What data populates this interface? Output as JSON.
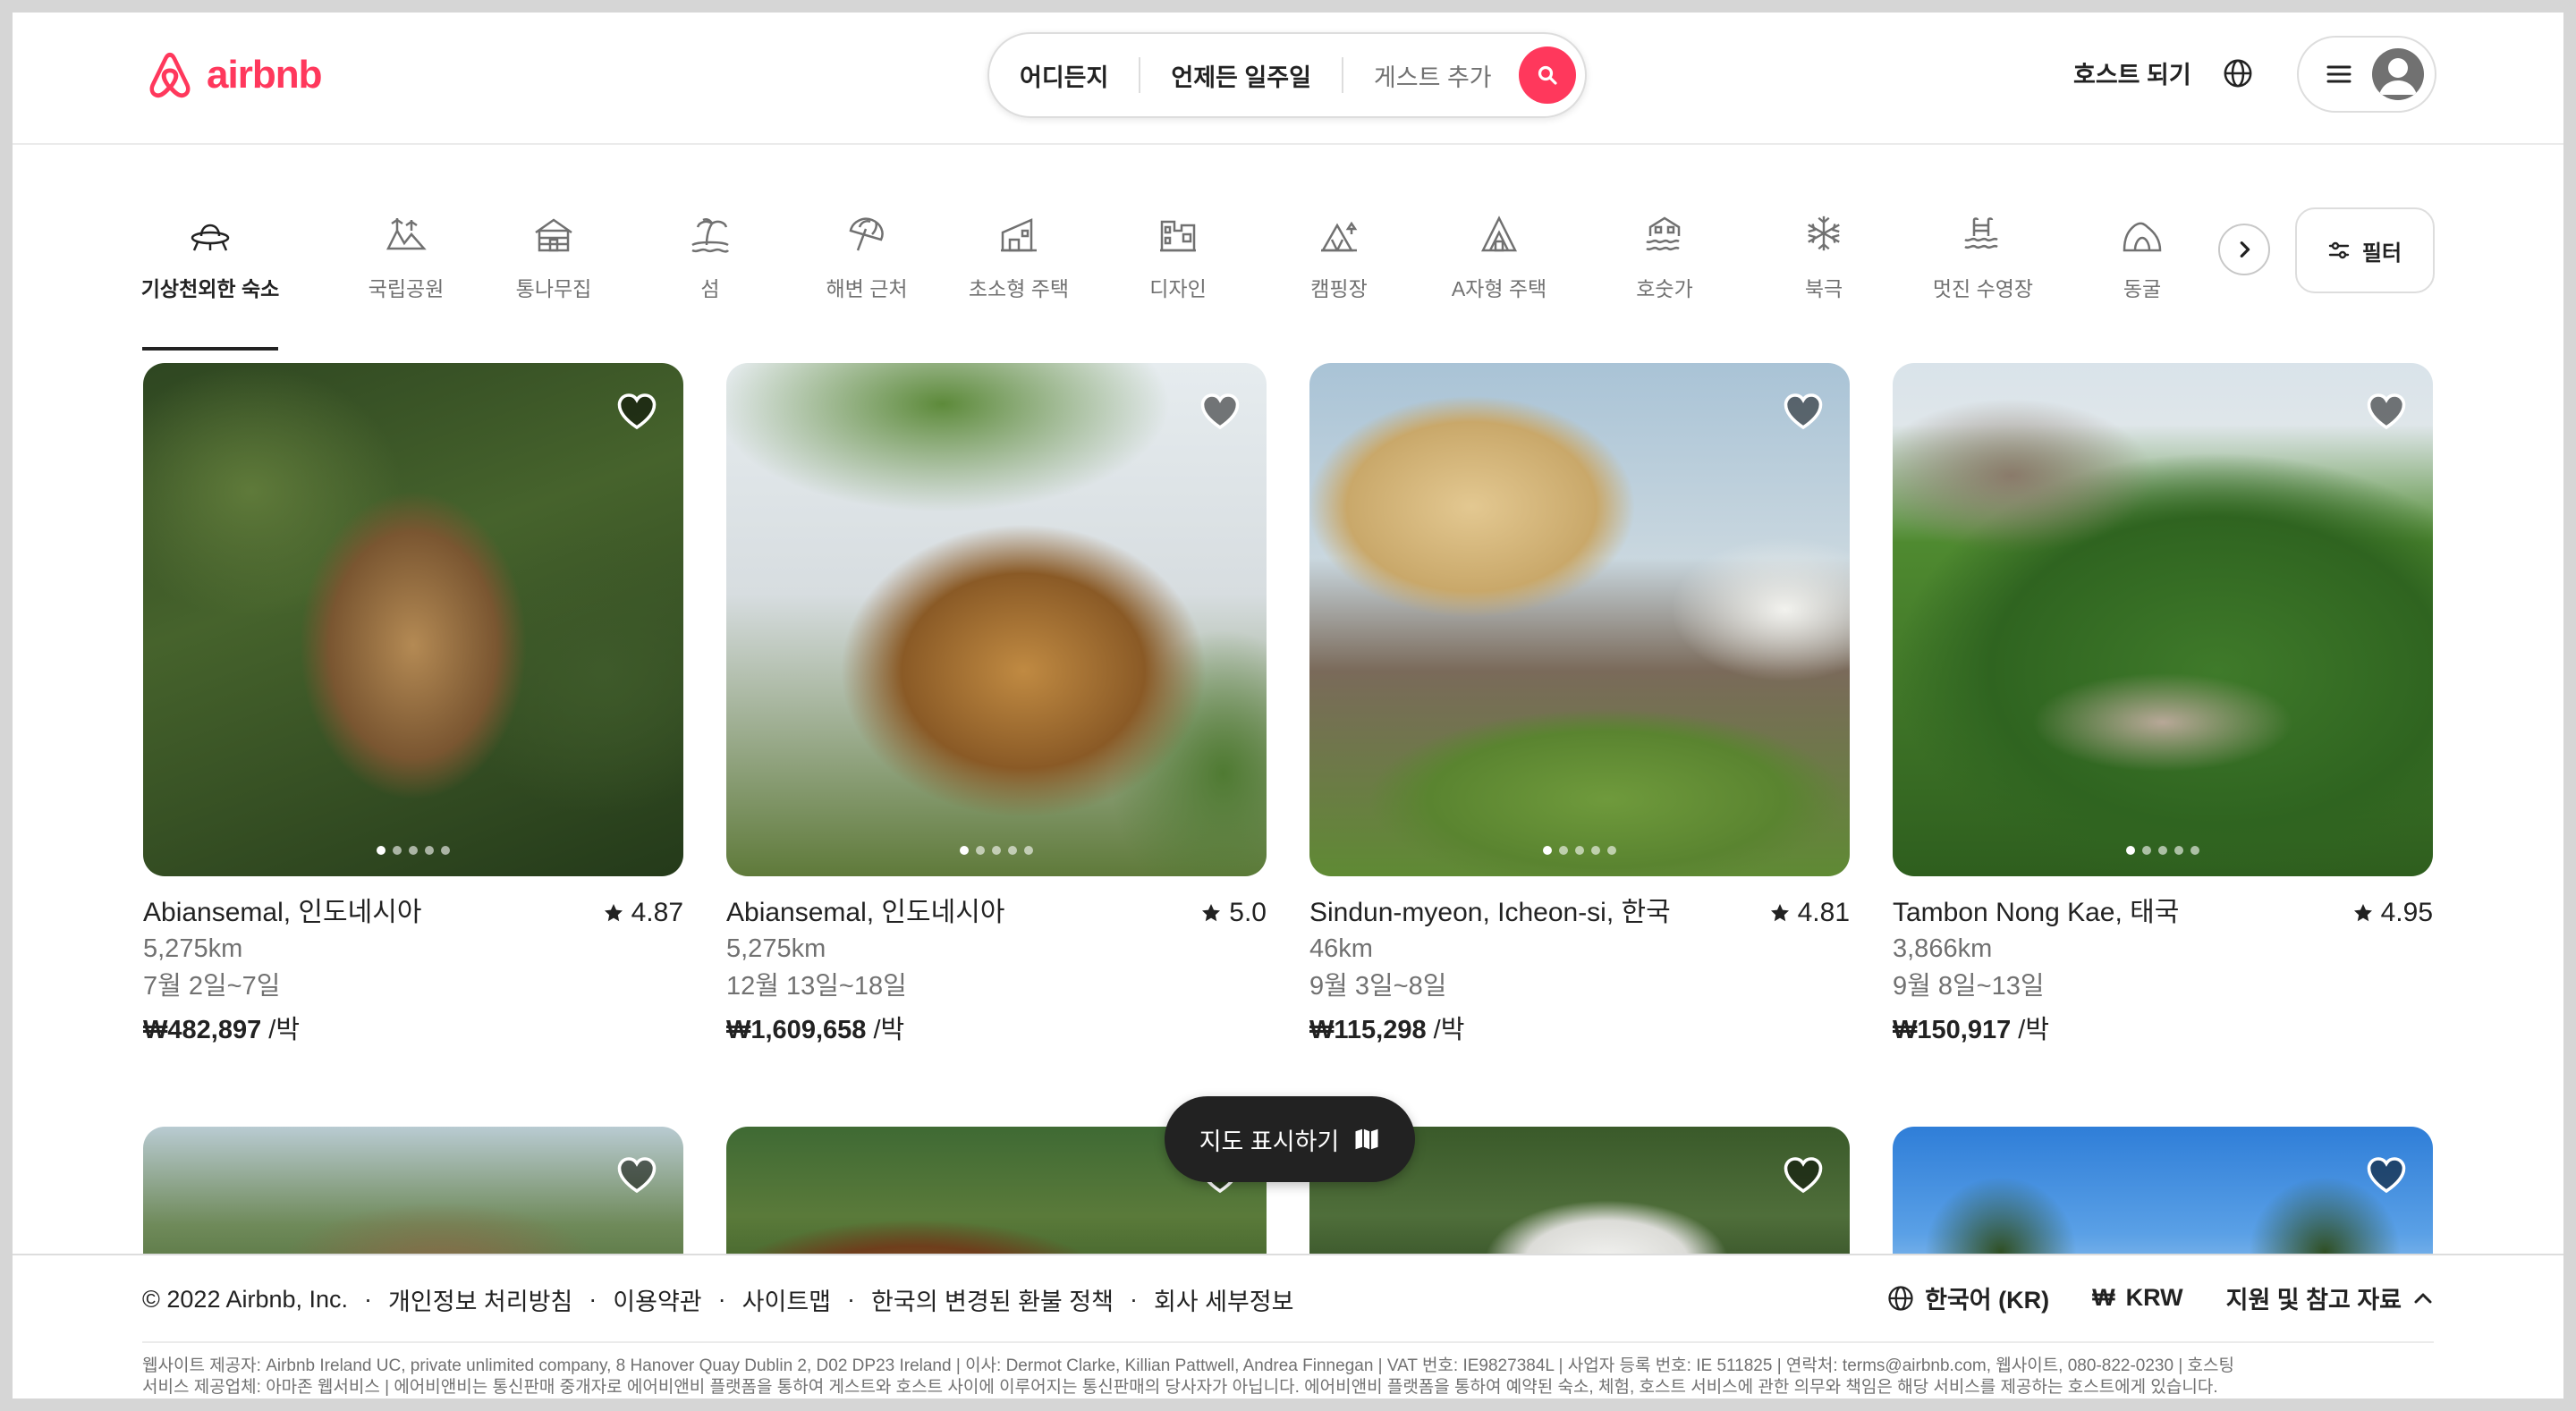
{
  "header": {
    "logo_text": "airbnb",
    "search": {
      "where": "어디든지",
      "when": "언제든 일주일",
      "guests": "게스트 추가"
    },
    "host_label": "호스트 되기"
  },
  "categories": {
    "items": [
      {
        "label": "기상천외한 숙소",
        "icon": "ufo-icon",
        "active": true
      },
      {
        "label": "국립공원",
        "icon": "national-park-icon"
      },
      {
        "label": "통나무집",
        "icon": "cabin-icon"
      },
      {
        "label": "섬",
        "icon": "island-icon"
      },
      {
        "label": "해변 근처",
        "icon": "beach-umbrella-icon"
      },
      {
        "label": "초소형 주택",
        "icon": "tiny-house-icon"
      },
      {
        "label": "디자인",
        "icon": "design-building-icon"
      },
      {
        "label": "캠핑장",
        "icon": "camping-icon"
      },
      {
        "label": "A자형 주택",
        "icon": "a-frame-icon"
      },
      {
        "label": "호숫가",
        "icon": "lake-icon"
      },
      {
        "label": "북극",
        "icon": "snowflake-icon"
      },
      {
        "label": "멋진 수영장",
        "icon": "pool-icon"
      },
      {
        "label": "동굴",
        "icon": "cave-icon"
      }
    ],
    "filter_label": "필터"
  },
  "listings": [
    {
      "location": "Abiansemal, 인도네시아",
      "rating": "4.87",
      "distance": "5,275km",
      "dates": "7월 2일~7일",
      "price": "₩482,897",
      "per": "/박"
    },
    {
      "location": "Abiansemal, 인도네시아",
      "rating": "5.0",
      "distance": "5,275km",
      "dates": "12월 13일~18일",
      "price": "₩1,609,658",
      "per": "/박"
    },
    {
      "location": "Sindun-myeon, Icheon-si, 한국",
      "rating": "4.81",
      "distance": "46km",
      "dates": "9월 3일~8일",
      "price": "₩115,298",
      "per": "/박"
    },
    {
      "location": "Tambon Nong Kae, 태국",
      "rating": "4.95",
      "distance": "3,866km",
      "dates": "9월 8일~13일",
      "price": "₩150,917",
      "per": "/박"
    }
  ],
  "map_button": "지도 표시하기",
  "footer": {
    "links": [
      "© 2022 Airbnb, Inc.",
      "개인정보 처리방침",
      "이용약관",
      "사이트맵",
      "한국의 변경된 환불 정책",
      "회사 세부정보"
    ],
    "language": "한국어 (KR)",
    "currency_symbol": "₩",
    "currency": "KRW",
    "support": "지원 및 참고 자료",
    "legal_1": "웹사이트 제공자: Airbnb Ireland UC, private unlimited company, 8 Hanover Quay Dublin 2, D02 DP23 Ireland | 이사: Dermot Clarke, Killian Pattwell, Andrea Finnegan | VAT 번호: IE9827384L | 사업자 등록 번호: IE 511825 | 연락처: terms@airbnb.com, 웹사이트, 080-822-0230 | 호스팅",
    "legal_2": "서비스 제공업체: 아마존 웹서비스 | 에어비앤비는 통신판매 중개자로 에어비앤비 플랫폼을 통하여 게스트와 호스트 사이에 이루어지는 통신판매의 당사자가 아닙니다. 에어비앤비 플랫폼을 통하여 예약된 숙소, 체험, 호스트 서비스에 관한 의무와 책임은 해당 서비스를 제공하는 호스트에게 있습니다."
  }
}
